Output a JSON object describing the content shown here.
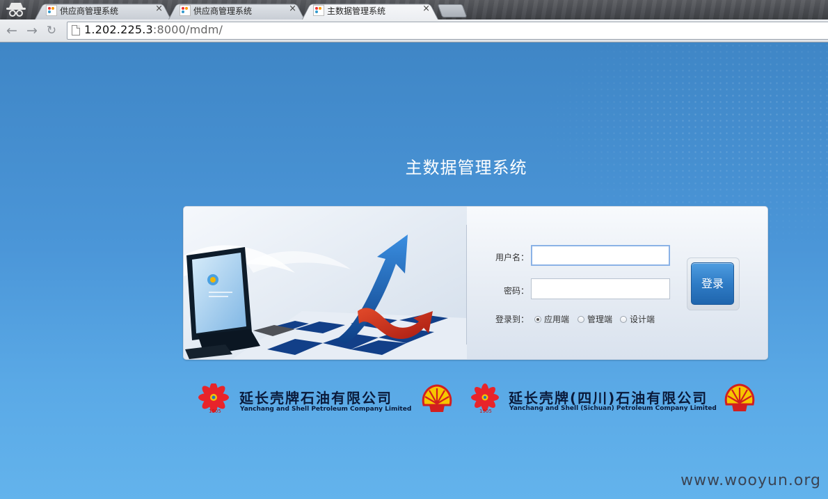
{
  "browser": {
    "tabs": [
      {
        "title": "供应商管理系统",
        "close": "×"
      },
      {
        "title": "供应商管理系统",
        "close": "×"
      },
      {
        "title": "主数据管理系统",
        "close": "×"
      }
    ],
    "url_host": "1.202.225.3",
    "url_rest": ":8000/mdm/"
  },
  "page": {
    "title": "主数据管理系统",
    "form": {
      "username_label": "用户名：",
      "password_label": "密码：",
      "login_to_label": "登录到：",
      "options": [
        {
          "label": "应用端",
          "checked": true
        },
        {
          "label": "管理端",
          "checked": false
        },
        {
          "label": "设计端",
          "checked": false
        }
      ],
      "login_button": "登录"
    },
    "logos": [
      {
        "name_cn": "延长壳牌石油有限公司",
        "name_en": "Yanchang and Shell Petroleum Company Limited",
        "year": "1905"
      },
      {
        "name_cn": "延长壳牌(四川)石油有限公司",
        "name_en": "Yanchang and Shell (Sichuan) Petroleum Company Limited",
        "year": "1905"
      }
    ],
    "watermark": "www.wooyun.org"
  }
}
